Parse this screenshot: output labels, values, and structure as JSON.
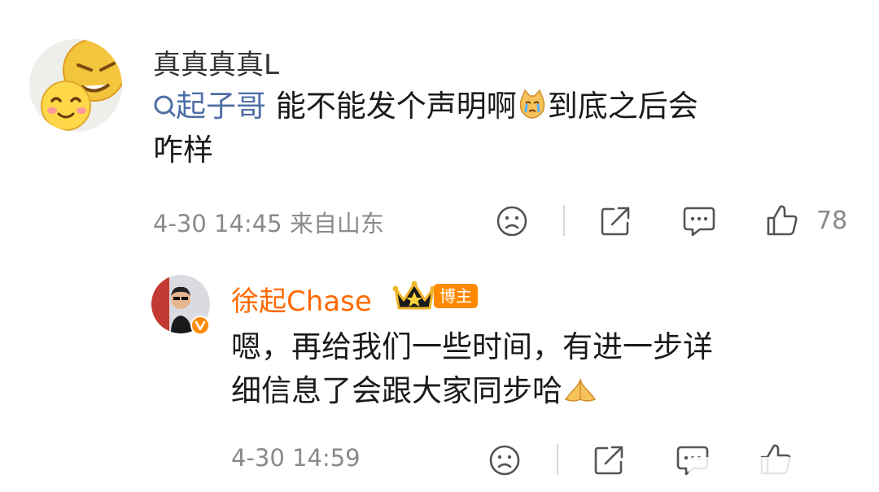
{
  "comment": {
    "username": "真真真真L",
    "mention": "起子哥",
    "text_part1": " 能不能发个声明啊",
    "text_part2": "到底之后会",
    "text_part3": "咋样",
    "timestamp": "4-30 14:45 来自山东",
    "like_count": "78"
  },
  "reply": {
    "username": "徐起Chase",
    "badge": "博主",
    "text_line1": "嗯，再给我们一些时间，有进一步详",
    "text_line2": "细信息了会跟大家同步哈",
    "timestamp": "4-30 14:59"
  },
  "icons": {
    "dislike": "sad-face-icon",
    "share": "share-icon",
    "comment": "comment-icon",
    "like": "thumbs-up-icon"
  },
  "colors": {
    "mention": "#4e6fa5",
    "blogger_name": "#ff6a00",
    "badge": "#ff8a00",
    "meta": "#8a8a8a"
  }
}
